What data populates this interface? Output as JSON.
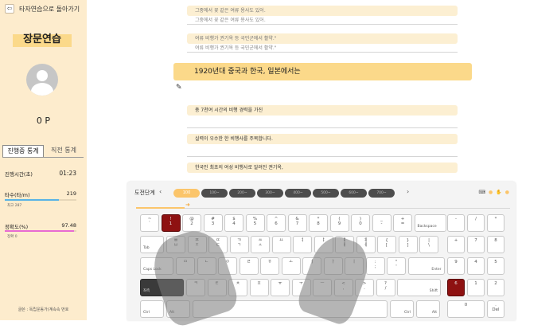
{
  "sidebar": {
    "back_label": "타자연습으로 돌아가기",
    "mode_title": "장문연습",
    "user_score": "0 P",
    "tabs": [
      "진행중 통계",
      "직전 통계"
    ],
    "stats": {
      "time_label": "진행시간(초)",
      "time_value": "01:23",
      "speed_label": "타수(타/m)",
      "speed_value": "219",
      "speed_sub": "최고 287",
      "speed_ratio": 0.76,
      "accuracy_label": "정확도(%)",
      "accuracy_value": "97.48",
      "accuracy_sub": "정확 0",
      "accuracy_ratio": 0.97
    },
    "footer": "글쓴 : 독립운동가(계속속 번호"
  },
  "practice": {
    "sentences": [
      {
        "text": "그중에서 꽃 같은 여류 용사도 있어.",
        "typed": "그중에서 꽃 같은 여류 용사도 있어."
      },
      {
        "text": "여류 비행가 권기옥 등 국민군에서 활약.\"",
        "typed": "여류 비행가 권기옥 등 국민군에서 활약.\""
      }
    ],
    "current": "1920년대 중국과 한국, 일본에서는",
    "upcoming": [
      "총 7천여 시간의 비행 경력을 가진",
      "실력이 우수한 한 비행사를 주목합니다.",
      "한국인 최초의 여성 비행사로 알려진 권기옥,"
    ]
  },
  "keyboard_panel": {
    "stage_label": "도전단계",
    "stages": [
      "100",
      "100~",
      "200~",
      "300~",
      "400~",
      "500~",
      "600~",
      "700~"
    ],
    "accent": "#fbc56b",
    "highlight": "#8e1111",
    "icons": [
      "keyboard-icon",
      "hand-icon"
    ]
  },
  "keys": {
    "row1": [
      [
        "~",
        "`"
      ],
      [
        "!",
        "1"
      ],
      [
        "@",
        "2"
      ],
      [
        "#",
        "3"
      ],
      [
        "$",
        "4"
      ],
      [
        "%",
        "5"
      ],
      [
        "^",
        "6"
      ],
      [
        "&",
        "7"
      ],
      [
        "*",
        "8"
      ],
      [
        "(",
        "9"
      ],
      [
        ")",
        "0"
      ],
      [
        "_",
        "-"
      ],
      [
        "+",
        "="
      ]
    ],
    "backspace": "Backspace",
    "tab": "Tab",
    "row2": [
      [
        "ㅃ",
        "ㅂ"
      ],
      [
        "ㅉ",
        "ㅈ"
      ],
      [
        "ㄸ",
        "ㄷ"
      ],
      [
        "ㄲ",
        "ㄱ"
      ],
      [
        "ㅆ",
        "ㅅ"
      ],
      [
        "",
        "ㅛ"
      ],
      [
        "",
        "ㅕ"
      ],
      [
        "",
        "ㅑ"
      ],
      [
        "ㅒ",
        "ㅐ"
      ],
      [
        "ㅖ",
        "ㅔ"
      ],
      [
        "{",
        "["
      ],
      [
        "}",
        "]"
      ],
      [
        "|",
        "\\"
      ]
    ],
    "caps": "Caps Lock",
    "row3": [
      "ㅁ",
      "ㄴ",
      "ㅇ",
      "ㄹ",
      "ㅎ",
      "ㅗ",
      "ㅓ",
      "ㅏ",
      "ㅣ"
    ],
    "row3_punct": [
      [
        ":",
        ";"
      ],
      [
        "\"",
        "'"
      ]
    ],
    "enter": "Enter",
    "shift": "Shift",
    "shift_left": "좌측",
    "row4": [
      "ㅋ",
      "ㅌ",
      "ㅊ",
      "ㅍ",
      "ㅠ",
      "ㅜ",
      "ㅡ"
    ],
    "row4_punct": [
      [
        "<",
        ","
      ],
      [
        ">",
        "."
      ],
      [
        "?",
        "/"
      ]
    ],
    "ctrl": "Ctrl",
    "alt": "Alt",
    "numpad": [
      "-",
      "/",
      "*",
      "+",
      "7",
      "8",
      "9",
      "4",
      "5",
      "6",
      "1",
      "2",
      "3",
      "0",
      "."
    ],
    "del": "Del"
  }
}
